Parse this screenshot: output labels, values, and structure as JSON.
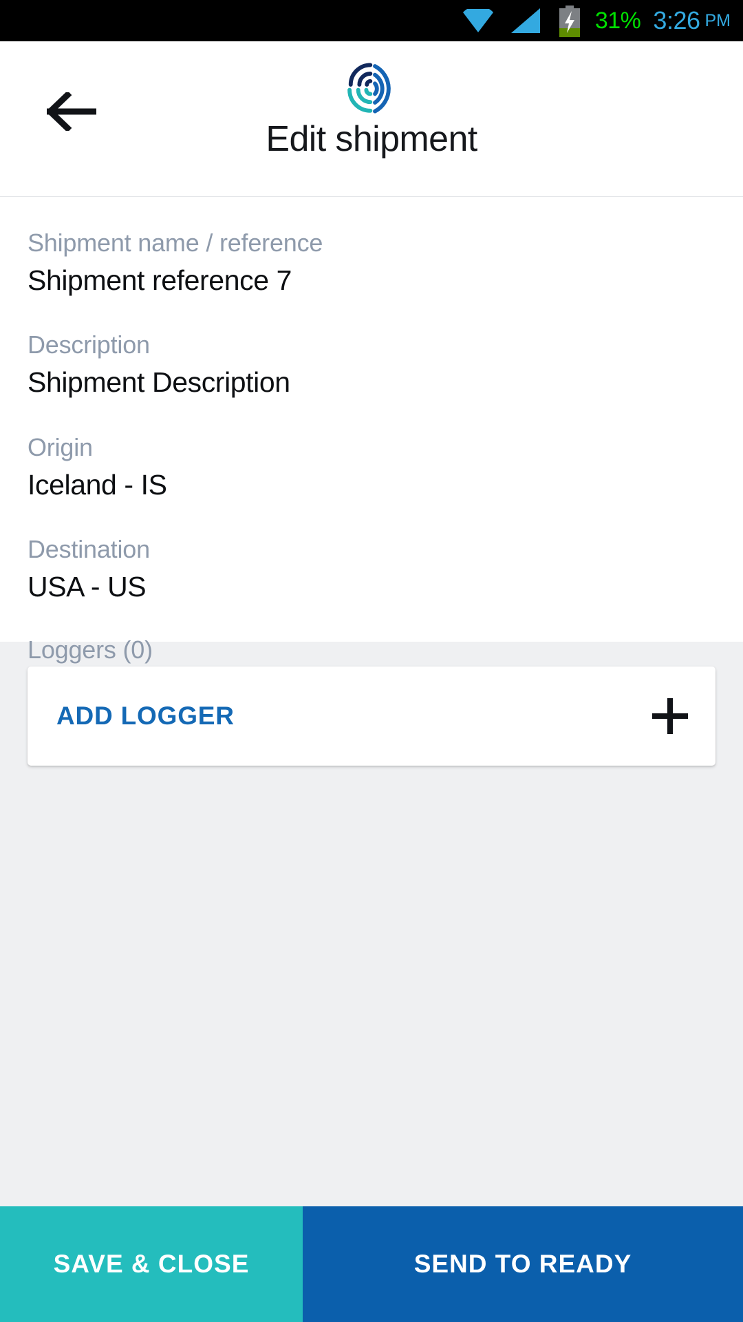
{
  "status_bar": {
    "wifi_icon": "wifi-icon",
    "signal_icon": "signal-icon",
    "battery_icon": "battery-charging-icon",
    "battery_percent": "31%",
    "time": "3:26",
    "am_pm": "PM",
    "battery_color": "#00e000",
    "time_color": "#33a9e0",
    "icon_color": "#33a9e0"
  },
  "header": {
    "back_icon": "back-arrow-icon",
    "logo_icon": "app-logo-icon",
    "title": "Edit shipment",
    "logo_colors": {
      "navy": "#12295c",
      "blue": "#1464b4",
      "teal": "#22b5b5"
    }
  },
  "form": {
    "fields": [
      {
        "label": "Shipment name / reference",
        "value": "Shipment reference 7"
      },
      {
        "label": "Description",
        "value": "Shipment Description"
      },
      {
        "label": "Origin",
        "value": "Iceland - IS"
      },
      {
        "label": "Destination",
        "value": "USA - US"
      }
    ],
    "loggers_section_label": "Loggers (0)"
  },
  "loggers": {
    "add_label": "ADD LOGGER",
    "add_icon": "plus-icon",
    "add_label_color": "#1469b5"
  },
  "actions": {
    "save_label": "SAVE & CLOSE",
    "send_label": "SEND TO READY",
    "save_color": "#24bdbd",
    "send_color": "#0b5fac"
  }
}
